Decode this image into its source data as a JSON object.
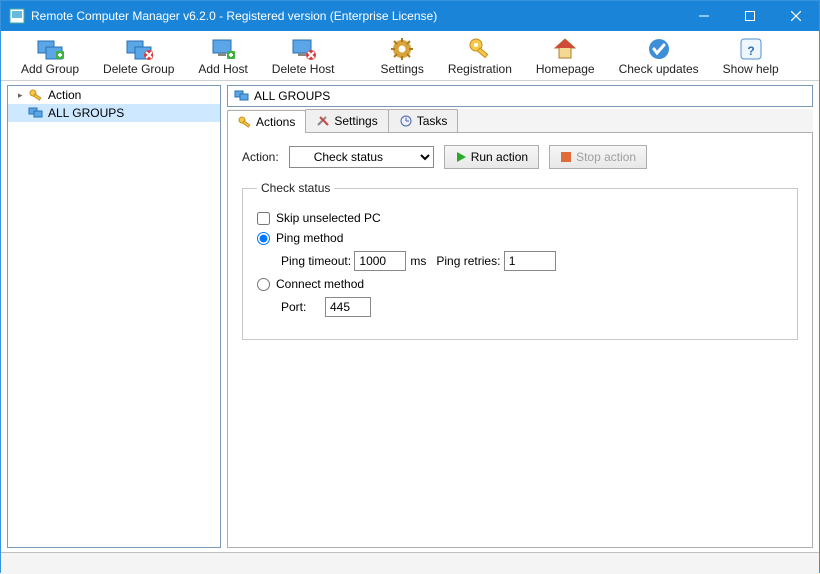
{
  "window": {
    "title": "Remote Computer Manager v6.2.0 - Registered version (Enterprise License)"
  },
  "toolbar": {
    "add_group": "Add Group",
    "delete_group": "Delete Group",
    "add_host": "Add Host",
    "delete_host": "Delete Host",
    "settings": "Settings",
    "registration": "Registration",
    "homepage": "Homepage",
    "check_updates": "Check updates",
    "show_help": "Show help"
  },
  "sidebar": {
    "items": [
      {
        "label": "Action"
      },
      {
        "label": "ALL GROUPS"
      }
    ]
  },
  "main": {
    "header": "ALL GROUPS",
    "tabs": {
      "actions": "Actions",
      "settings": "Settings",
      "tasks": "Tasks"
    },
    "action_label": "Action:",
    "action_options": [
      "Check status"
    ],
    "action_selected": "Check status",
    "run_action": "Run action",
    "stop_action": "Stop action",
    "group_legend": "Check status",
    "skip_unselected": "Skip unselected PC",
    "ping_method": "Ping method",
    "ping_timeout_label": "Ping timeout:",
    "ping_timeout_value": "1000",
    "ms": "ms",
    "ping_retries_label": "Ping retries:",
    "ping_retries_value": "1",
    "connect_method": "Connect method",
    "port_label": "Port:",
    "port_value": "445"
  }
}
